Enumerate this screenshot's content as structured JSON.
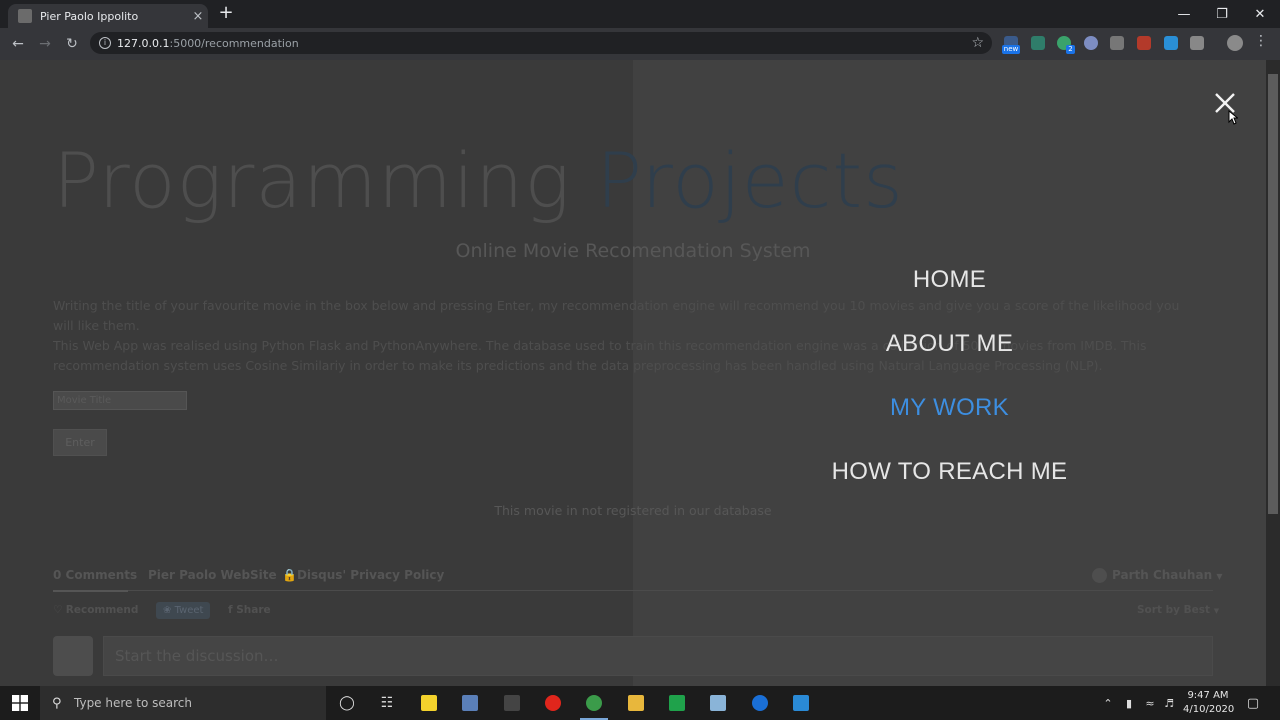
{
  "browser": {
    "tab_title": "Pier Paolo Ippolito",
    "tab_close": "×",
    "new_tab": "+",
    "url_host": "127.0.0.1",
    "url_path": ":5000/recommendation"
  },
  "page": {
    "title_part1": "Programming",
    "title_part2": "Projects",
    "subtitle": "Online Movie Recomendation System",
    "para1": "Writing the title of your favourite movie in the box below and pressing Enter, my recommendation engine will recommend you 10 movies and give you a score of the likelihood you will like them.",
    "para2": "This Web App was realised using Python Flask and PythonAnywhere. The database used to train this recommendation engine was a collection of 5000 movies from IMDB. This recommendation system uses Cosine Similariy in order to make its predictions and the data preprocessing has been handled using Natural Language Processing (NLP).",
    "input_placeholder": "Movie Title",
    "enter_label": "Enter",
    "not_registered": "This movie in not registered in our database"
  },
  "disqus": {
    "comments_tab": "0 Comments",
    "site_tab": "Pier Paolo WebSite",
    "privacy": "Disqus' Privacy Policy",
    "user": "Parth Chauhan",
    "recommend": "Recommend",
    "tweet": "Tweet",
    "share": "Share",
    "sort": "Sort by Best",
    "discussion_placeholder": "Start the discussion…"
  },
  "menu": {
    "items": [
      {
        "label": "HOME"
      },
      {
        "label": "ABOUT ME"
      },
      {
        "label": "MY WORK",
        "active": true
      },
      {
        "label": "HOW TO REACH ME"
      }
    ],
    "accent_color": "#3d8ee0"
  },
  "taskbar": {
    "search_placeholder": "Type here to search",
    "time": "9:47 AM",
    "date": "4/10/2020",
    "ext_badge_new": "new",
    "ext_badge_count": "2"
  }
}
